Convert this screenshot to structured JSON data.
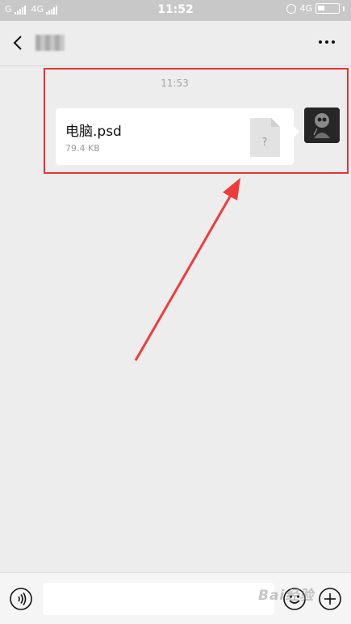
{
  "status_bar": {
    "carrier1": "G",
    "carrier2": "4G",
    "time": "11:52",
    "network_right": "4G"
  },
  "header": {
    "back_icon": "chevron-left-icon",
    "contact_name": "",
    "more_icon": "ellipsis-icon"
  },
  "chat": {
    "timestamp": "11:53",
    "file": {
      "name": "电脑.psd",
      "size": "79.4 KB",
      "icon_symbol": "?"
    }
  },
  "input_bar": {
    "voice_icon": "voice-icon",
    "emoji_icon": "emoji-icon",
    "plus_icon": "plus-icon"
  },
  "watermark": "Bai经验",
  "colors": {
    "highlight": "#e53232",
    "background": "#ededed",
    "bubble": "#ffffff"
  }
}
